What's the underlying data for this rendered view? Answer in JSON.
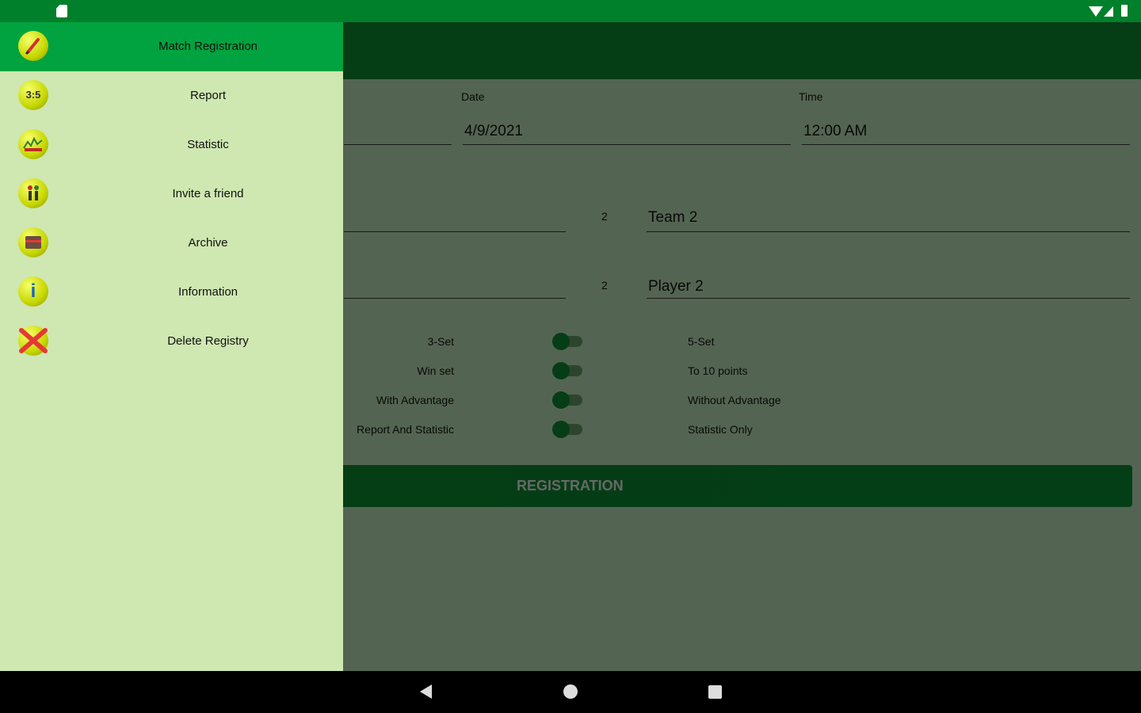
{
  "status_bar": {
    "icons": [
      "sd-card-icon",
      "wifi-icon",
      "signal-icon",
      "battery-icon"
    ]
  },
  "form": {
    "date_label": "Date",
    "date_value": "4/9/2021",
    "time_label": "Time",
    "time_value": "12:00 AM",
    "team_number": "2",
    "team_value": "Team 2",
    "player_number": "2",
    "player_value": "Player 2",
    "options": [
      {
        "left": "3-Set",
        "right": "5-Set"
      },
      {
        "left": "Win set",
        "right": "To 10 points"
      },
      {
        "left": "With Advantage",
        "right": "Without Advantage"
      },
      {
        "left": "Report And Statistic",
        "right": "Statistic Only"
      }
    ],
    "registration_button": "REGISTRATION"
  },
  "drawer": {
    "items": [
      {
        "label": "Match Registration",
        "icon": "pencil-icon",
        "active": true
      },
      {
        "label": "Report",
        "icon": "score-icon",
        "active": false
      },
      {
        "label": "Statistic",
        "icon": "chart-icon",
        "active": false
      },
      {
        "label": "Invite a friend",
        "icon": "people-icon",
        "active": false
      },
      {
        "label": "Archive",
        "icon": "archive-box-icon",
        "active": false
      },
      {
        "label": "Information",
        "icon": "info-icon",
        "active": false
      },
      {
        "label": "Delete Registry",
        "icon": "delete-x-icon",
        "active": false
      }
    ],
    "score_icon_text": "3:5",
    "info_icon_text": "i"
  },
  "colors": {
    "status_bar": "#00802a",
    "drawer_bg": "#cfe7b1",
    "drawer_active": "#00a33f",
    "accent_green": "#0a7a2b"
  },
  "nav_bar": {
    "icons": [
      "back-icon",
      "home-icon",
      "recents-icon"
    ]
  }
}
